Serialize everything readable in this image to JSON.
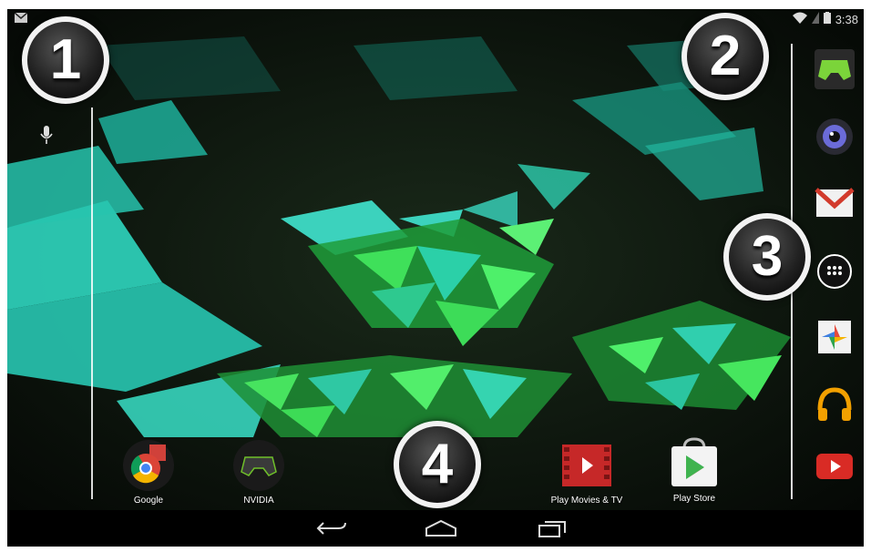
{
  "status_bar": {
    "time": "3:38",
    "notification_icon": "gmail-notification-icon",
    "wifi_icon": "wifi-icon",
    "battery_icon": "battery-icon"
  },
  "callouts": [
    "1",
    "2",
    "3",
    "4"
  ],
  "search": {
    "mic_icon": "microphone-icon"
  },
  "dock": {
    "items": [
      {
        "name": "NVIDIA Shield",
        "icon": "shield-controller-icon"
      },
      {
        "name": "Camera",
        "icon": "camera-icon"
      },
      {
        "name": "Gmail",
        "icon": "gmail-icon"
      },
      {
        "name": "All apps",
        "icon": "app-drawer-icon"
      },
      {
        "name": "Photos",
        "icon": "photos-icon"
      },
      {
        "name": "Play Music",
        "icon": "headphones-icon"
      },
      {
        "name": "YouTube",
        "icon": "youtube-icon"
      }
    ]
  },
  "home": {
    "apps": [
      {
        "label": "Google",
        "icon": "google-folder-icon"
      },
      {
        "label": "NVIDIA",
        "icon": "nvidia-folder-icon"
      },
      {
        "label": "Play Movies & TV",
        "icon": "play-movies-icon"
      },
      {
        "label": "Play Store",
        "icon": "play-store-icon"
      }
    ]
  },
  "navbar": {
    "back": "back-icon",
    "home": "home-icon",
    "recents": "recents-icon"
  },
  "colors": {
    "accent_cyan": "#2ee0c0",
    "accent_green": "#3cd43c",
    "background": "#000000"
  }
}
